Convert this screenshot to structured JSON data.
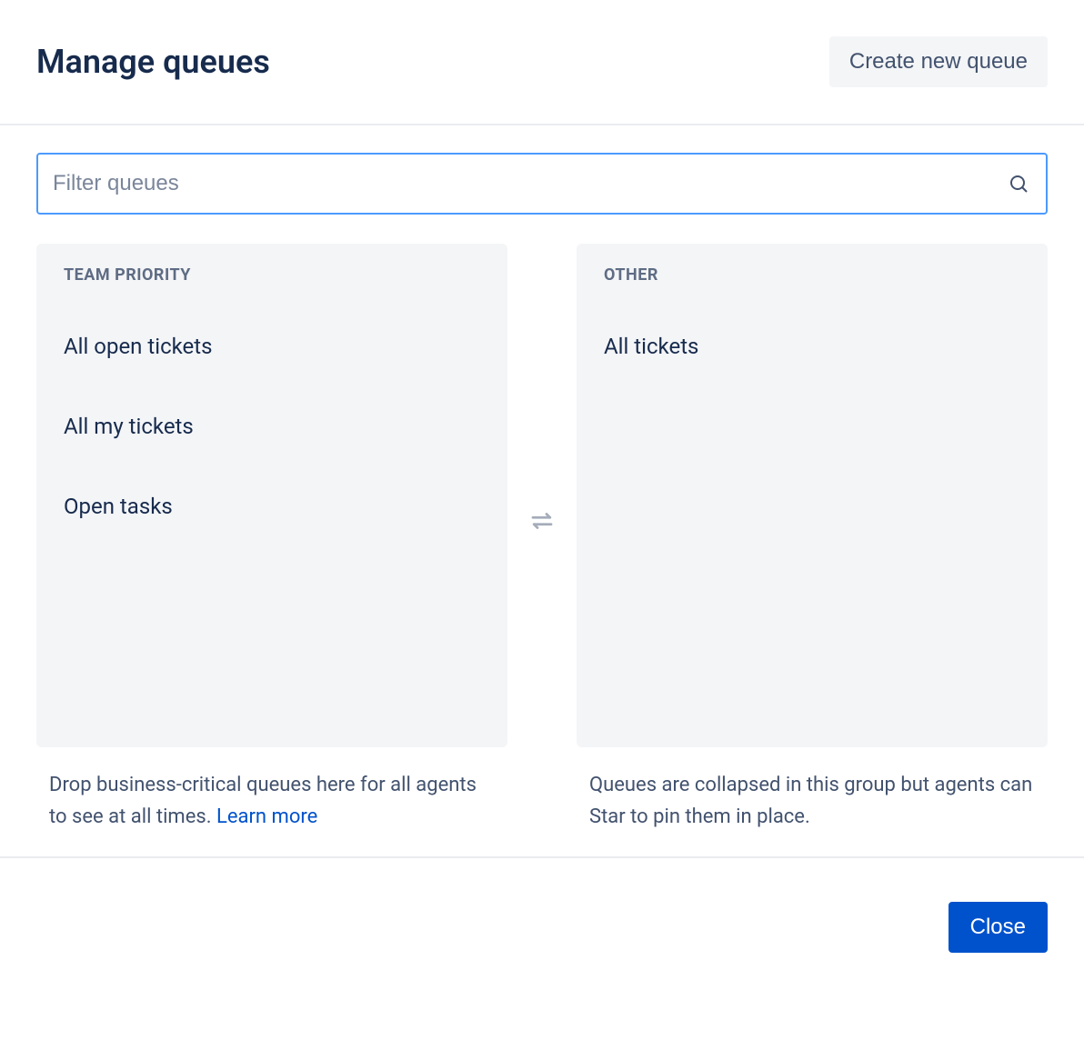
{
  "header": {
    "title": "Manage queues",
    "create_button": "Create new queue"
  },
  "search": {
    "placeholder": "Filter queues"
  },
  "columns": {
    "left": {
      "title": "TEAM PRIORITY",
      "items": [
        "All open tickets",
        "All my tickets",
        "Open tasks"
      ],
      "description": "Drop business-critical queues here for all agents to see at all times. ",
      "learn_more": "Learn more"
    },
    "right": {
      "title": "OTHER",
      "items": [
        "All tickets"
      ],
      "description": "Queues are collapsed in this group but agents can Star to pin them in place."
    }
  },
  "footer": {
    "close": "Close"
  }
}
